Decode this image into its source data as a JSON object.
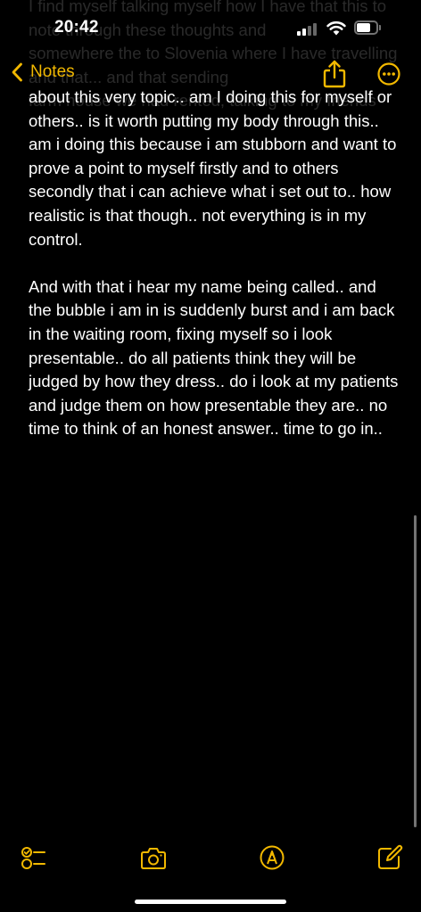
{
  "status": {
    "time": "20:42"
  },
  "nav": {
    "back_label": "Notes"
  },
  "note": {
    "hidden_top_text": "I find myself talking myself how I have that this to\nnote through these thoughts and\nsomewhere the to Slovenia where I have travelling\nand that... and that sending\nfarm house we had rented, talking to my friends",
    "paragraphs": [
      "about this very topic.. am I doing this for myself or others.. is it worth putting my body through this.. am i doing this because i am stubborn and want to prove a point to myself firstly and to others secondly that i can achieve what i set out to.. how realistic is that though.. not everything is in my control.",
      "And with that i hear my name being called.. and the bubble i am in is suddenly burst and i am back in the waiting room, fixing myself so i look presentable.. do all patients think they will be judged by how they dress.. do i look at my patients and judge them on how presentable they are.. no time to think of an honest answer.. time to go in.."
    ]
  },
  "toolbar": {
    "icons": [
      "checklist-icon",
      "camera-icon",
      "markup-icon",
      "compose-icon"
    ]
  },
  "colors": {
    "accent": "#f2b800",
    "background": "#000000",
    "text": "#ffffff"
  }
}
